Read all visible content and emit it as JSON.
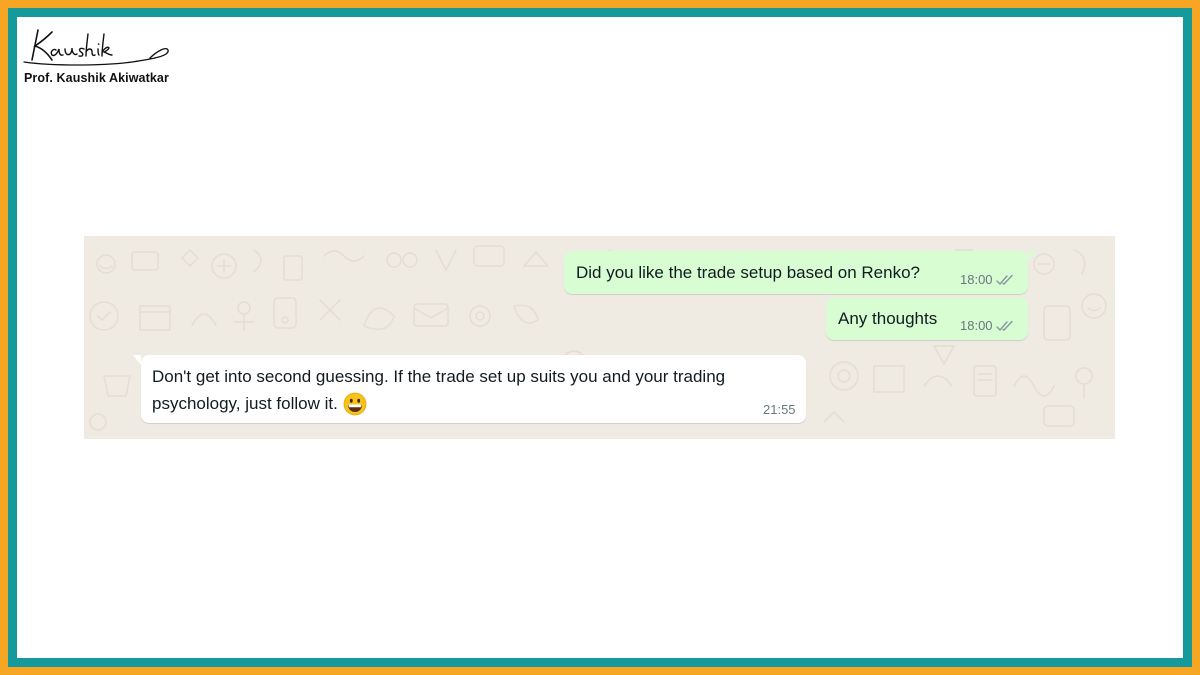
{
  "brand": {
    "signature_text": "Kaushik",
    "name": "Prof. Kaushik Akiwatkar"
  },
  "colors": {
    "outer_border": "#f6a623",
    "inner_border": "#16999a",
    "chat_background": "#efeae2",
    "outgoing_bubble": "#d9fdd3",
    "incoming_bubble": "#ffffff",
    "read_ticks": "#8696a0"
  },
  "messages": [
    {
      "direction": "outgoing",
      "text": "Did you like the trade setup based on Renko?",
      "time": "18:00",
      "status_icon": "double-check-icon"
    },
    {
      "direction": "outgoing",
      "text": "Any thoughts",
      "time": "18:00",
      "status_icon": "double-check-icon"
    },
    {
      "direction": "incoming",
      "text_line1": "Don't get into second guessing. If the trade set up suits you and your trading",
      "text_line2": "psychology, just follow it.",
      "emoji": "grinning-face-emoji",
      "time": "21:55"
    }
  ]
}
